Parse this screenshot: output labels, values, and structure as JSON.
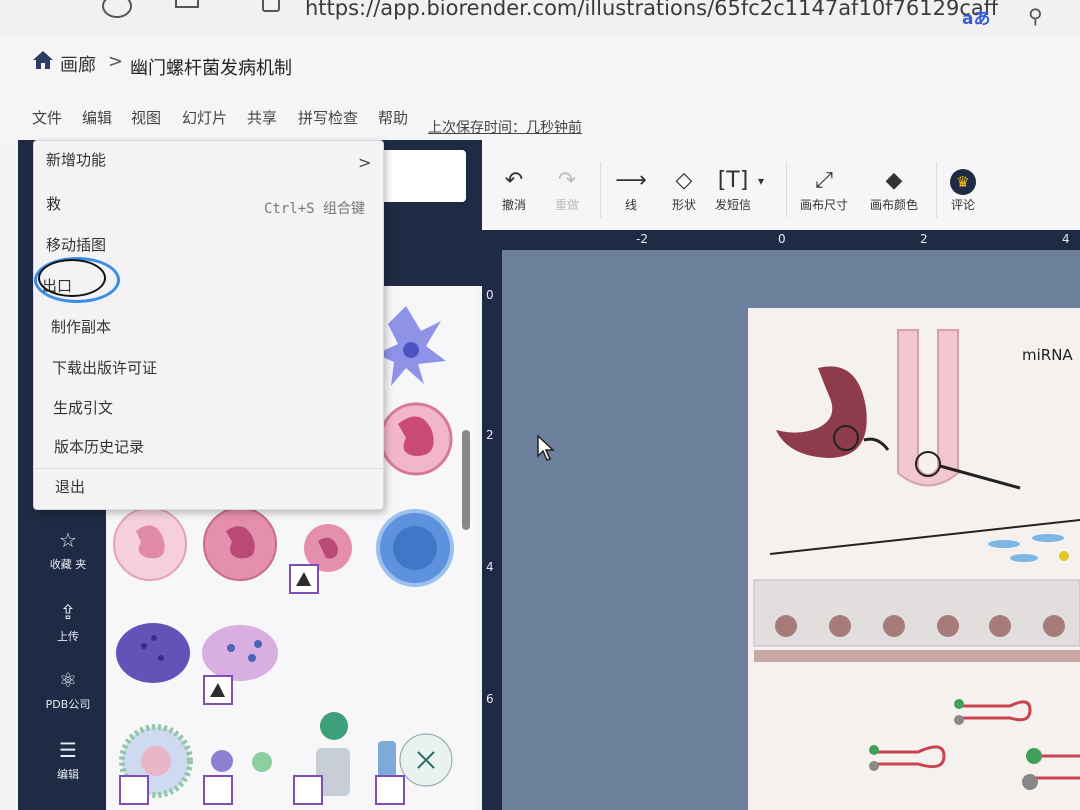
{
  "browser": {
    "url": "https://app.biorender.com/illustrations/65fc2c1147af10f76129caff",
    "translate_label": "aあ"
  },
  "breadcrumb": {
    "root": "画廊",
    "separator": ">",
    "title": "幽门螺杆菌发病机制"
  },
  "menubar": {
    "items": [
      "文件",
      "编辑",
      "视图",
      "幻灯片",
      "共享",
      "拼写检查",
      "帮助"
    ],
    "last_saved": "上次保存时间：几秒钟前"
  },
  "file_menu": {
    "items": [
      {
        "label": "新增功能",
        "submenu": ">"
      },
      {
        "label": "救",
        "shortcut": "Ctrl+S 组合键"
      },
      {
        "label": "移动插图"
      },
      {
        "label": "出口"
      },
      {
        "label": "制作副本"
      },
      {
        "label": "下载出版许可证"
      },
      {
        "label": "生成引文"
      },
      {
        "label": "版本历史记录"
      },
      {
        "label": "退出"
      }
    ]
  },
  "toolbar": {
    "undo": "撤消",
    "redo": "重做",
    "line": "线",
    "shape": "形状",
    "text": "发短信",
    "canvas_size": "画布尺寸",
    "canvas_color": "画布颜色",
    "comment": "评论"
  },
  "sidebar": {
    "favorites": "收藏 夹",
    "upload": "上传",
    "pdb": "PDB公司",
    "edit": "编辑"
  },
  "ruler": {
    "top": [
      "-2",
      "0",
      "2",
      "4"
    ],
    "left": [
      "0",
      "2",
      "4",
      "6"
    ]
  },
  "artboard": {
    "label": "miRNA"
  },
  "colors": {
    "dark_panel": "#1f2b44",
    "canvas_bg": "#6c7f9b",
    "cell_pink": "#d77a98",
    "highlight_blue": "#3b8ee8"
  }
}
